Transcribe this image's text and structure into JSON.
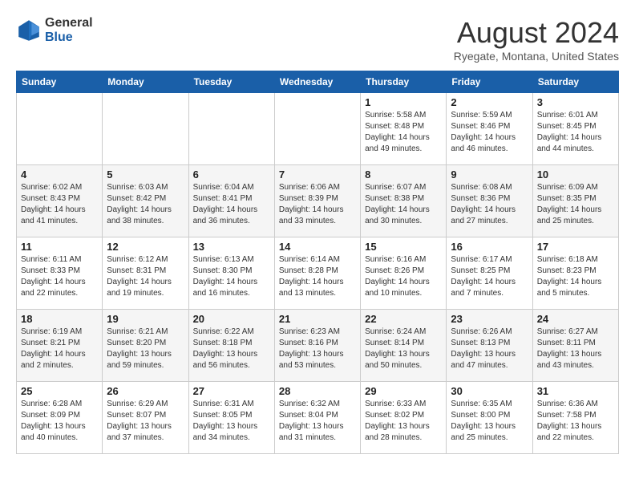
{
  "logo": {
    "general": "General",
    "blue": "Blue"
  },
  "header": {
    "month_year": "August 2024",
    "location": "Ryegate, Montana, United States"
  },
  "weekdays": [
    "Sunday",
    "Monday",
    "Tuesday",
    "Wednesday",
    "Thursday",
    "Friday",
    "Saturday"
  ],
  "weeks": [
    [
      {
        "day": "",
        "info": ""
      },
      {
        "day": "",
        "info": ""
      },
      {
        "day": "",
        "info": ""
      },
      {
        "day": "",
        "info": ""
      },
      {
        "day": "1",
        "info": "Sunrise: 5:58 AM\nSunset: 8:48 PM\nDaylight: 14 hours\nand 49 minutes."
      },
      {
        "day": "2",
        "info": "Sunrise: 5:59 AM\nSunset: 8:46 PM\nDaylight: 14 hours\nand 46 minutes."
      },
      {
        "day": "3",
        "info": "Sunrise: 6:01 AM\nSunset: 8:45 PM\nDaylight: 14 hours\nand 44 minutes."
      }
    ],
    [
      {
        "day": "4",
        "info": "Sunrise: 6:02 AM\nSunset: 8:43 PM\nDaylight: 14 hours\nand 41 minutes."
      },
      {
        "day": "5",
        "info": "Sunrise: 6:03 AM\nSunset: 8:42 PM\nDaylight: 14 hours\nand 38 minutes."
      },
      {
        "day": "6",
        "info": "Sunrise: 6:04 AM\nSunset: 8:41 PM\nDaylight: 14 hours\nand 36 minutes."
      },
      {
        "day": "7",
        "info": "Sunrise: 6:06 AM\nSunset: 8:39 PM\nDaylight: 14 hours\nand 33 minutes."
      },
      {
        "day": "8",
        "info": "Sunrise: 6:07 AM\nSunset: 8:38 PM\nDaylight: 14 hours\nand 30 minutes."
      },
      {
        "day": "9",
        "info": "Sunrise: 6:08 AM\nSunset: 8:36 PM\nDaylight: 14 hours\nand 27 minutes."
      },
      {
        "day": "10",
        "info": "Sunrise: 6:09 AM\nSunset: 8:35 PM\nDaylight: 14 hours\nand 25 minutes."
      }
    ],
    [
      {
        "day": "11",
        "info": "Sunrise: 6:11 AM\nSunset: 8:33 PM\nDaylight: 14 hours\nand 22 minutes."
      },
      {
        "day": "12",
        "info": "Sunrise: 6:12 AM\nSunset: 8:31 PM\nDaylight: 14 hours\nand 19 minutes."
      },
      {
        "day": "13",
        "info": "Sunrise: 6:13 AM\nSunset: 8:30 PM\nDaylight: 14 hours\nand 16 minutes."
      },
      {
        "day": "14",
        "info": "Sunrise: 6:14 AM\nSunset: 8:28 PM\nDaylight: 14 hours\nand 13 minutes."
      },
      {
        "day": "15",
        "info": "Sunrise: 6:16 AM\nSunset: 8:26 PM\nDaylight: 14 hours\nand 10 minutes."
      },
      {
        "day": "16",
        "info": "Sunrise: 6:17 AM\nSunset: 8:25 PM\nDaylight: 14 hours\nand 7 minutes."
      },
      {
        "day": "17",
        "info": "Sunrise: 6:18 AM\nSunset: 8:23 PM\nDaylight: 14 hours\nand 5 minutes."
      }
    ],
    [
      {
        "day": "18",
        "info": "Sunrise: 6:19 AM\nSunset: 8:21 PM\nDaylight: 14 hours\nand 2 minutes."
      },
      {
        "day": "19",
        "info": "Sunrise: 6:21 AM\nSunset: 8:20 PM\nDaylight: 13 hours\nand 59 minutes."
      },
      {
        "day": "20",
        "info": "Sunrise: 6:22 AM\nSunset: 8:18 PM\nDaylight: 13 hours\nand 56 minutes."
      },
      {
        "day": "21",
        "info": "Sunrise: 6:23 AM\nSunset: 8:16 PM\nDaylight: 13 hours\nand 53 minutes."
      },
      {
        "day": "22",
        "info": "Sunrise: 6:24 AM\nSunset: 8:14 PM\nDaylight: 13 hours\nand 50 minutes."
      },
      {
        "day": "23",
        "info": "Sunrise: 6:26 AM\nSunset: 8:13 PM\nDaylight: 13 hours\nand 47 minutes."
      },
      {
        "day": "24",
        "info": "Sunrise: 6:27 AM\nSunset: 8:11 PM\nDaylight: 13 hours\nand 43 minutes."
      }
    ],
    [
      {
        "day": "25",
        "info": "Sunrise: 6:28 AM\nSunset: 8:09 PM\nDaylight: 13 hours\nand 40 minutes."
      },
      {
        "day": "26",
        "info": "Sunrise: 6:29 AM\nSunset: 8:07 PM\nDaylight: 13 hours\nand 37 minutes."
      },
      {
        "day": "27",
        "info": "Sunrise: 6:31 AM\nSunset: 8:05 PM\nDaylight: 13 hours\nand 34 minutes."
      },
      {
        "day": "28",
        "info": "Sunrise: 6:32 AM\nSunset: 8:04 PM\nDaylight: 13 hours\nand 31 minutes."
      },
      {
        "day": "29",
        "info": "Sunrise: 6:33 AM\nSunset: 8:02 PM\nDaylight: 13 hours\nand 28 minutes."
      },
      {
        "day": "30",
        "info": "Sunrise: 6:35 AM\nSunset: 8:00 PM\nDaylight: 13 hours\nand 25 minutes."
      },
      {
        "day": "31",
        "info": "Sunrise: 6:36 AM\nSunset: 7:58 PM\nDaylight: 13 hours\nand 22 minutes."
      }
    ]
  ]
}
